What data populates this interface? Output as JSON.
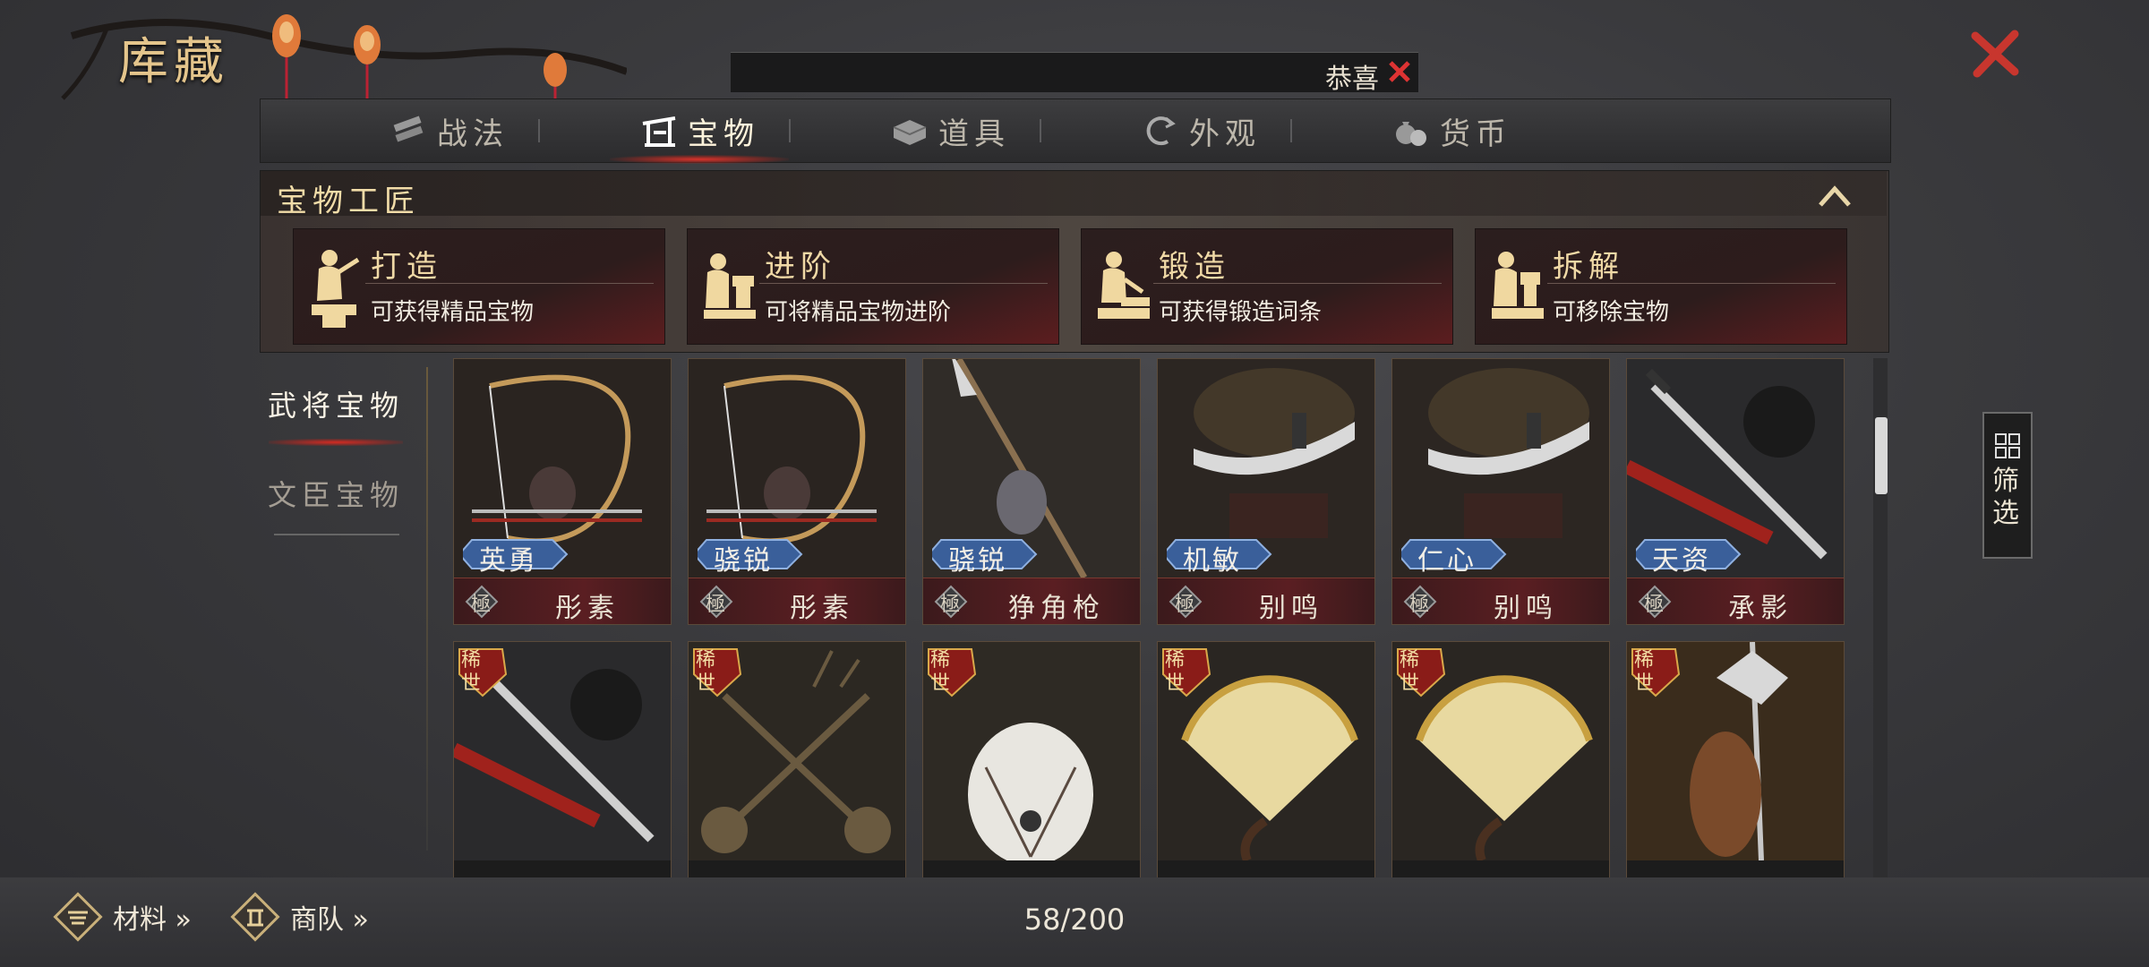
{
  "window": {
    "title": "库藏",
    "close_icon": "close-x-icon"
  },
  "notice": {
    "text": "恭喜"
  },
  "tabs": [
    {
      "label": "战法",
      "icon": "scroll-bundle-icon",
      "active": false
    },
    {
      "label": "宝物",
      "icon": "treasure-gate-icon",
      "active": true
    },
    {
      "label": "道具",
      "icon": "item-box-icon",
      "active": false
    },
    {
      "label": "外观",
      "icon": "appearance-swirl-icon",
      "active": false
    },
    {
      "label": "货币",
      "icon": "money-bag-icon",
      "active": false
    }
  ],
  "craft": {
    "title": "宝物工匠",
    "actions": [
      {
        "name": "打造",
        "desc": "可获得精品宝物",
        "icon": "blacksmith-hammer-icon"
      },
      {
        "name": "进阶",
        "desc": "可将精品宝物进阶",
        "icon": "blacksmith-anvil-icon"
      },
      {
        "name": "锻造",
        "desc": "可获得锻造词条",
        "icon": "blacksmith-forge-icon"
      },
      {
        "name": "拆解",
        "desc": "可移除宝物",
        "icon": "blacksmith-dismantle-icon"
      }
    ]
  },
  "side": {
    "active": "武将宝物",
    "inactive": "文臣宝物"
  },
  "grade_label": "極",
  "rare_label": "稀世",
  "items_row1": [
    {
      "trait": "英勇",
      "name": "彤素",
      "art": "bow"
    },
    {
      "trait": "骁锐",
      "name": "彤素",
      "art": "bow"
    },
    {
      "trait": "骁锐",
      "name": "狰角枪",
      "art": "spear"
    },
    {
      "trait": "机敏",
      "name": "别鸣",
      "art": "blade"
    },
    {
      "trait": "仁心",
      "name": "别鸣",
      "art": "blade"
    },
    {
      "trait": "天资",
      "name": "承影",
      "art": "sword"
    }
  ],
  "items_row2": [
    {
      "art": "sword"
    },
    {
      "art": "maces"
    },
    {
      "art": "feather"
    },
    {
      "art": "fan"
    },
    {
      "art": "fan"
    },
    {
      "art": "halberd"
    }
  ],
  "filter": {
    "label": "筛选",
    "icon": "grid-filter-icon"
  },
  "bottom": {
    "materials": "材料 »",
    "caravan": "商队 »",
    "count": "58/200"
  },
  "colors": {
    "accent_red": "#d42a22",
    "gold": "#e4c58c",
    "card_foot": "#5a1e22"
  }
}
